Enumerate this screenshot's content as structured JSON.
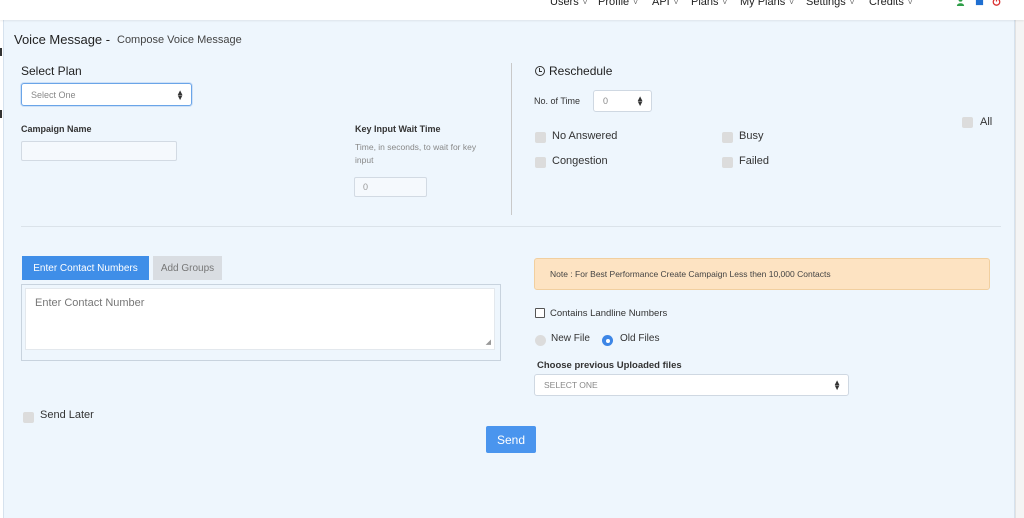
{
  "nav": {
    "items": [
      {
        "label": "Users"
      },
      {
        "label": "Profile"
      },
      {
        "label": "API"
      },
      {
        "label": "Plans"
      },
      {
        "label": "My Plans"
      },
      {
        "label": "Settings"
      },
      {
        "label": "Credits"
      }
    ],
    "icons": [
      "user-icon",
      "square-icon",
      "power-icon"
    ],
    "icon_colors": [
      "#2e9e48",
      "#1f6fd1",
      "#d93030"
    ]
  },
  "page": {
    "title": "Voice Message -",
    "subtitle": "Compose Voice Message"
  },
  "plan": {
    "label": "Select Plan",
    "selected": "Select One"
  },
  "campaign": {
    "label": "Campaign Name",
    "value": ""
  },
  "key_input": {
    "label": "Key Input Wait Time",
    "help": "Time, in seconds, to wait for key input",
    "value": "0"
  },
  "reschedule": {
    "title": "Reschedule",
    "no_of_time_label": "No. of Time",
    "no_of_time_value": "0",
    "options": {
      "no_answered": "No Answered",
      "busy": "Busy",
      "congestion": "Congestion",
      "failed": "Failed",
      "all": "All"
    }
  },
  "contacts": {
    "tab_enter": "Enter Contact Numbers",
    "tab_groups": "Add Groups",
    "placeholder": "Enter Contact Number"
  },
  "note": "Note : For Best Performance Create Campaign Less then 10,000 Contacts",
  "landline_label": "Contains Landline Numbers",
  "file_mode": {
    "new_file": "New File",
    "old_files": "Old Files",
    "selected": "old_files"
  },
  "previous_files": {
    "label": "Choose previous Uploaded files",
    "selected": "SELECT ONE"
  },
  "send_later_label": "Send Later",
  "send_label": "Send",
  "colors": {
    "accent": "#3f8ee8",
    "panel_bg": "#eef6fd",
    "note_bg": "#fde3c2"
  }
}
